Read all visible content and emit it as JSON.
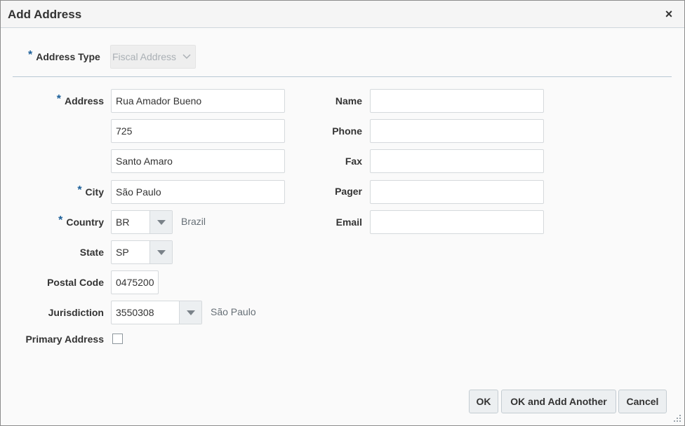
{
  "dialog": {
    "title": "Add Address",
    "close_label": "×"
  },
  "address_type": {
    "label": "Address Type",
    "value": "Fiscal Address"
  },
  "address": {
    "label": "Address",
    "line1": "Rua Amador Bueno",
    "line2": "725",
    "line3": "Santo Amaro"
  },
  "city": {
    "label": "City",
    "value": "São Paulo"
  },
  "country": {
    "label": "Country",
    "value": "BR",
    "description": "Brazil"
  },
  "state": {
    "label": "State",
    "value": "SP"
  },
  "postal_code": {
    "label": "Postal Code",
    "value": "0475200"
  },
  "jurisdiction": {
    "label": "Jurisdiction",
    "value": "3550308",
    "description": "São Paulo"
  },
  "primary_address": {
    "label": "Primary Address",
    "checked": false
  },
  "contact": {
    "name_label": "Name",
    "name_value": "",
    "phone_label": "Phone",
    "phone_value": "",
    "fax_label": "Fax",
    "fax_value": "",
    "pager_label": "Pager",
    "pager_value": "",
    "email_label": "Email",
    "email_value": ""
  },
  "buttons": {
    "ok": "OK",
    "ok_add_another": "OK and Add Another",
    "cancel": "Cancel"
  },
  "required_marker": "*",
  "colors": {
    "required": "#1b5f99",
    "divider": "#b8c9d4",
    "button_bg": "#eceff1"
  }
}
